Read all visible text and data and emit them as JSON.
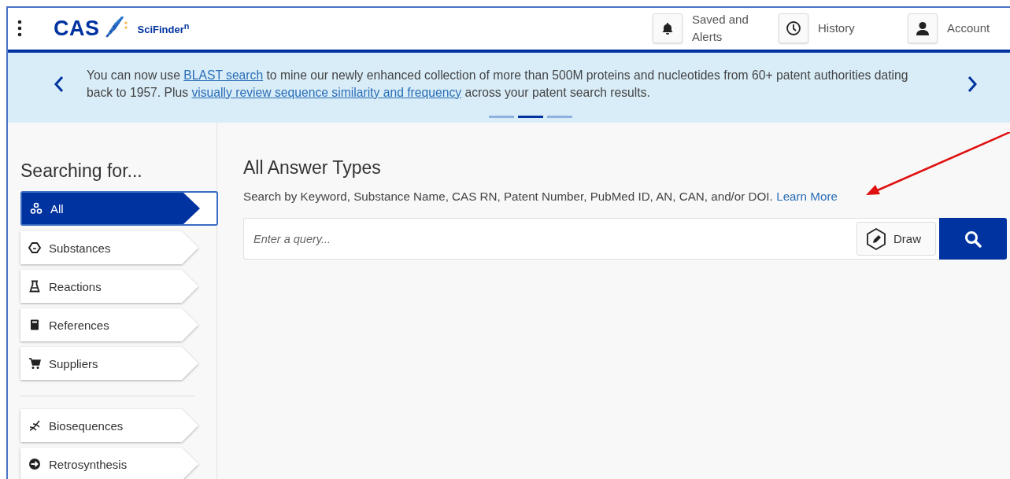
{
  "header": {
    "logo": "CAS",
    "product": "SciFinder$^{n}$",
    "actions": [
      {
        "kind": "bell",
        "label": "Saved and Alerts"
      },
      {
        "kind": "clock",
        "label": "History"
      },
      {
        "kind": "person",
        "label": "Account"
      }
    ]
  },
  "banner": {
    "parts": [
      {
        "kind": "text",
        "text": "You can now use "
      },
      {
        "kind": "link",
        "text": "BLAST search"
      },
      {
        "kind": "text",
        "text": " to mine our newly enhanced collection of more than 500M proteins and nucleotides from 60+ patent authorities dating back to 1957. Plus "
      },
      {
        "kind": "link",
        "text": "visually review sequence similarity and frequency"
      },
      {
        "kind": "text",
        "text": " across your patent search results."
      }
    ],
    "indicators": [
      {
        "selected": false
      },
      {
        "selected": true
      },
      {
        "selected": false
      }
    ]
  },
  "sidebar": {
    "title": "Searching for...",
    "groups": [
      [
        {
          "kind": "all",
          "label": "All",
          "selected": true
        },
        {
          "kind": "substances",
          "label": "Substances",
          "selected": false
        },
        {
          "kind": "reactions",
          "label": "Reactions",
          "selected": false
        },
        {
          "kind": "references",
          "label": "References",
          "selected": false
        },
        {
          "kind": "suppliers",
          "label": "Suppliers",
          "selected": false
        }
      ],
      [
        {
          "kind": "biosequences",
          "label": "Biosequences",
          "selected": false
        },
        {
          "kind": "retrosynthesis",
          "label": "Retrosynthesis",
          "selected": false
        }
      ]
    ]
  },
  "main": {
    "title": "All Answer Types",
    "hint": "Search by Keyword, Substance Name, CAS RN, Patent Number, PubMed ID, AN, CAN, and/or DOI.",
    "learn_more": "Learn More",
    "search": {
      "placeholder": "Enter a query...",
      "draw_label": "Draw"
    }
  }
}
